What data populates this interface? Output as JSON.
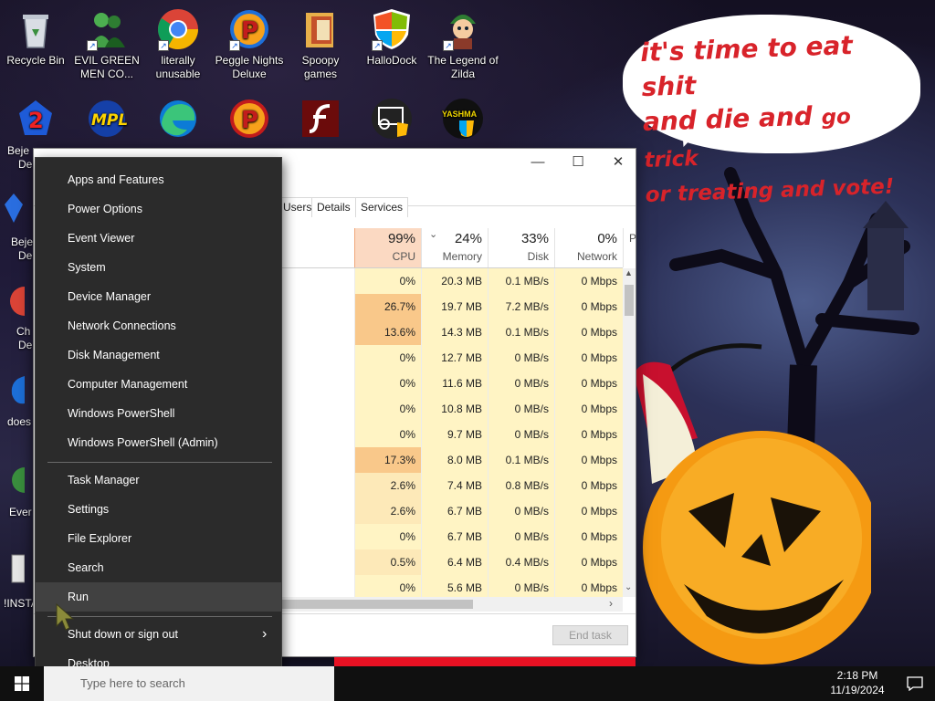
{
  "desktop": {
    "icons_row1": [
      {
        "label": "Recycle Bin"
      },
      {
        "label": "EVIL GREEN MEN CO..."
      },
      {
        "label": "literally unusable"
      },
      {
        "label": "Peggle Nights Deluxe"
      },
      {
        "label": "Spoopy games"
      },
      {
        "label": "HalloDock"
      },
      {
        "label": "The Legend of Zilda"
      }
    ],
    "partial_labels": [
      "Beje",
      "De",
      "Beje",
      "De",
      "Ch",
      "De",
      "does",
      "Ever",
      "!INSTA"
    ],
    "yashma_label": "YASHMA",
    "speech_bubble": {
      "line1": "it's time to eat shit",
      "line2a": "and die and",
      "line2b": "go trick",
      "line3": "or treating and vote!"
    }
  },
  "task_manager": {
    "tabs": [
      "Users",
      "Details",
      "Services"
    ],
    "columns": [
      {
        "pct": "99%",
        "label": "CPU"
      },
      {
        "pct": "24%",
        "label": "Memory"
      },
      {
        "pct": "33%",
        "label": "Disk"
      },
      {
        "pct": "0%",
        "label": "Network"
      },
      {
        "pct": "",
        "label": "P"
      }
    ],
    "rows": [
      {
        "cpu": "0%",
        "mem": "20.3 MB",
        "disk": "0.1 MB/s",
        "net": "0 Mbps"
      },
      {
        "cpu": "26.7%",
        "mem": "19.7 MB",
        "disk": "7.2 MB/s",
        "net": "0 Mbps"
      },
      {
        "cpu": "13.6%",
        "mem": "14.3 MB",
        "disk": "0.1 MB/s",
        "net": "0 Mbps"
      },
      {
        "cpu": "0%",
        "mem": "12.7 MB",
        "disk": "0 MB/s",
        "net": "0 Mbps"
      },
      {
        "cpu": "0%",
        "mem": "11.6 MB",
        "disk": "0 MB/s",
        "net": "0 Mbps"
      },
      {
        "cpu": "0%",
        "mem": "10.8 MB",
        "disk": "0 MB/s",
        "net": "0 Mbps"
      },
      {
        "cpu": "0%",
        "mem": "9.7 MB",
        "disk": "0 MB/s",
        "net": "0 Mbps"
      },
      {
        "cpu": "17.3%",
        "mem": "8.0 MB",
        "disk": "0.1 MB/s",
        "net": "0 Mbps"
      },
      {
        "cpu": "2.6%",
        "mem": "7.4 MB",
        "disk": "0.8 MB/s",
        "net": "0 Mbps"
      },
      {
        "cpu": "2.6%",
        "mem": "6.7 MB",
        "disk": "0 MB/s",
        "net": "0 Mbps"
      },
      {
        "cpu": "0%",
        "mem": "6.7 MB",
        "disk": "0 MB/s",
        "net": "0 Mbps"
      },
      {
        "cpu": "0.5%",
        "mem": "6.4 MB",
        "disk": "0.4 MB/s",
        "net": "0 Mbps"
      },
      {
        "cpu": "0%",
        "mem": "5.6 MB",
        "disk": "0 MB/s",
        "net": "0 Mbps"
      }
    ],
    "end_task_label": "End task",
    "colors": {
      "cpu_hot": "#f9c88a",
      "cpu_warm": "#fde9b8",
      "cpu_cool": "#fff4c4"
    }
  },
  "winx_menu": {
    "group1": [
      "Apps and Features",
      "Power Options",
      "Event Viewer",
      "System",
      "Device Manager",
      "Network Connections",
      "Disk Management",
      "Computer Management",
      "Windows PowerShell",
      "Windows PowerShell (Admin)"
    ],
    "group2": [
      "Task Manager",
      "Settings",
      "File Explorer",
      "Search",
      "Run"
    ],
    "group3": [
      "Shut down or sign out",
      "Desktop"
    ],
    "highlighted": "Run"
  },
  "taskbar": {
    "search_placeholder": "Type here to search",
    "time": "2:18 PM",
    "date": "11/19/2024"
  }
}
